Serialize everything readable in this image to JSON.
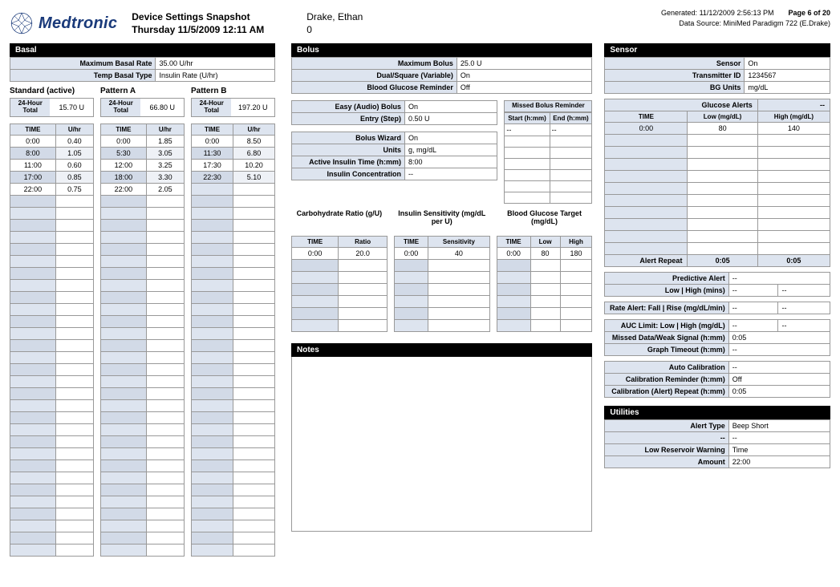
{
  "header": {
    "brand": "Medtronic",
    "title": "Device Settings Snapshot",
    "date": "Thursday 11/5/2009 12:11 AM",
    "patient": "Drake, Ethan",
    "zero": "0",
    "generated": "Generated: 11/12/2009 2:56:13 PM",
    "page": "Page 6 of 20",
    "source": "Data Source: MiniMed Paradigm 722 (E.Drake)"
  },
  "basal": {
    "title": "Basal",
    "maxRateL": "Maximum Basal Rate",
    "maxRateV": "35.00 U/hr",
    "tempTypeL": "Temp Basal Type",
    "tempTypeV": "Insulin Rate (U/hr)",
    "standard": {
      "label": "Standard (active)",
      "totL": "24-Hour Total",
      "totV": "15.70 U",
      "headers": [
        "TIME",
        "U/hr"
      ],
      "rows": [
        [
          "0:00",
          "0.40"
        ],
        [
          "8:00",
          "1.05"
        ],
        [
          "11:00",
          "0.60"
        ],
        [
          "17:00",
          "0.85"
        ],
        [
          "22:00",
          "0.75"
        ]
      ]
    },
    "patternA": {
      "label": "Pattern A",
      "totL": "24-Hour Total",
      "totV": "66.80 U",
      "headers": [
        "TIME",
        "U/hr"
      ],
      "rows": [
        [
          "0:00",
          "1.85"
        ],
        [
          "5:30",
          "3.05"
        ],
        [
          "12:00",
          "3.25"
        ],
        [
          "18:00",
          "3.30"
        ],
        [
          "22:00",
          "2.05"
        ]
      ]
    },
    "patternB": {
      "label": "Pattern B",
      "totL": "24-Hour Total",
      "totV": "197.20 U",
      "headers": [
        "TIME",
        "U/hr"
      ],
      "rows": [
        [
          "0:00",
          "8.50"
        ],
        [
          "11:30",
          "6.80"
        ],
        [
          "17:30",
          "10.20"
        ],
        [
          "22:30",
          "5.10"
        ]
      ]
    }
  },
  "bolus": {
    "title": "Bolus",
    "rows1": [
      [
        "Maximum Bolus",
        "25.0 U"
      ],
      [
        "Dual/Square (Variable)",
        "On"
      ],
      [
        "Blood Glucose Reminder",
        "Off"
      ]
    ],
    "rows2": [
      [
        "Easy (Audio) Bolus",
        "On"
      ],
      [
        "Entry (Step)",
        "0.50 U"
      ]
    ],
    "rows3": [
      [
        "Bolus Wizard",
        "On"
      ],
      [
        "Units",
        "g, mg/dL"
      ],
      [
        "Active Insulin Time (h:mm)",
        "8:00"
      ],
      [
        "Insulin Concentration",
        "--"
      ]
    ],
    "missed": {
      "title": "Missed Bolus Reminder",
      "h": [
        "Start (h:mm)",
        "End (h:mm)"
      ],
      "rows": [
        [
          "--",
          "--"
        ]
      ]
    },
    "carb": {
      "label": "Carbohydrate Ratio (g/U)",
      "h": [
        "TIME",
        "Ratio"
      ],
      "rows": [
        [
          "0:00",
          "20.0"
        ]
      ]
    },
    "sens": {
      "label": "Insulin Sensitivity (mg/dL per U)",
      "h": [
        "TIME",
        "Sensitivity"
      ],
      "rows": [
        [
          "0:00",
          "40"
        ]
      ]
    },
    "bg": {
      "label": "Blood Glucose Target (mg/dL)",
      "h": [
        "TIME",
        "Low",
        "High"
      ],
      "rows": [
        [
          "0:00",
          "80",
          "180"
        ]
      ]
    }
  },
  "notes": {
    "title": "Notes"
  },
  "sensor": {
    "title": "Sensor",
    "rows": [
      [
        "Sensor",
        "On"
      ],
      [
        "Transmitter ID",
        "1234567"
      ],
      [
        "BG Units",
        "mg/dL"
      ]
    ],
    "glucose": {
      "title": "Glucose Alerts",
      "titleV": "--",
      "h": [
        "TIME",
        "Low (mg/dL)",
        "High (mg/dL)"
      ],
      "rows": [
        [
          "0:00",
          "80",
          "140"
        ]
      ],
      "footL": "Alert Repeat",
      "footV1": "0:05",
      "footV2": "0:05"
    },
    "pred": [
      [
        "Predictive Alert",
        "--",
        ""
      ],
      [
        "Low | High (mins)",
        "--",
        "--"
      ]
    ],
    "rate": [
      [
        "Rate Alert: Fall | Rise (mg/dL/min)",
        "--",
        "--"
      ]
    ],
    "auc": [
      [
        "AUC Limit: Low | High (mg/dL)",
        "--",
        "--"
      ],
      [
        "Missed Data/Weak Signal (h:mm)",
        "0:05",
        ""
      ],
      [
        "Graph Timeout (h:mm)",
        "--",
        ""
      ]
    ],
    "cal": [
      [
        "Auto Calibration",
        "--"
      ],
      [
        "Calibration Reminder (h:mm)",
        "Off"
      ],
      [
        "Calibration (Alert) Repeat (h:mm)",
        "0:05"
      ]
    ]
  },
  "util": {
    "title": "Utilities",
    "rows": [
      [
        "Alert Type",
        "Beep Short"
      ],
      [
        "--",
        "--"
      ],
      [
        "Low Reservoir Warning",
        "Time"
      ],
      [
        "Amount",
        "22:00"
      ]
    ]
  }
}
